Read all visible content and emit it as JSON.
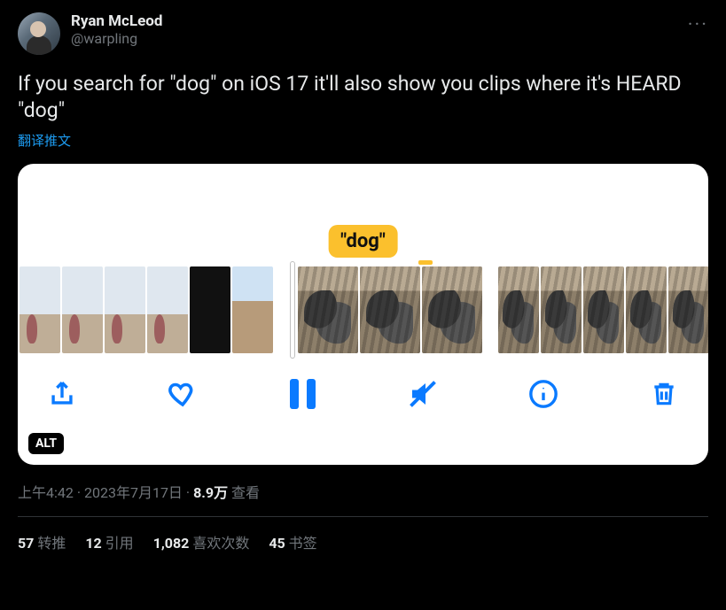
{
  "author": {
    "display_name": "Ryan McLeod",
    "handle": "@warpling"
  },
  "tweet_text": "If you search for \"dog\" on iOS 17 it'll also show you clips where it's HEARD \"dog\"",
  "translate_label": "翻译推文",
  "media": {
    "caption_pill": "\"dog\"",
    "alt_badge": "ALT"
  },
  "meta": {
    "time": "上午4:42",
    "date": "2023年7月17日",
    "views_value": "8.9万",
    "views_label": "查看"
  },
  "stats": {
    "retweets": {
      "value": "57",
      "label": "转推"
    },
    "quotes": {
      "value": "12",
      "label": "引用"
    },
    "likes": {
      "value": "1,082",
      "label": "喜欢次数"
    },
    "bookmarks": {
      "value": "45",
      "label": "书签"
    }
  }
}
